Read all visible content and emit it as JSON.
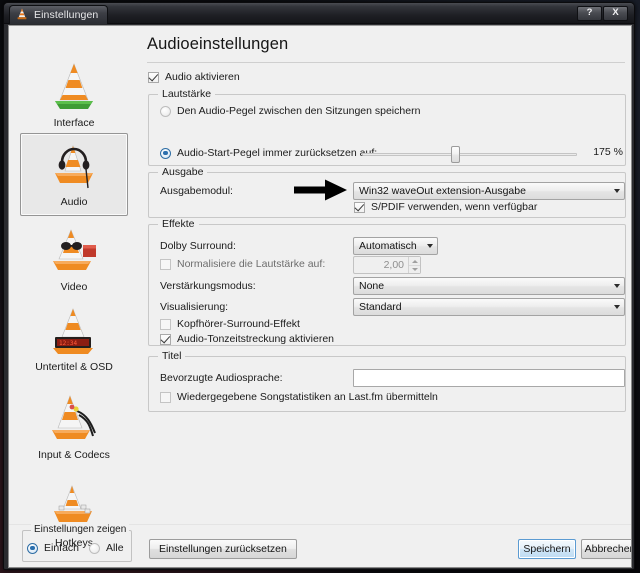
{
  "window": {
    "titlebar": {
      "icon": "vlc-cone-icon",
      "title": "Einstellungen",
      "help_label": "?",
      "close_label": "X"
    }
  },
  "sidebar": {
    "items": [
      {
        "label": "Interface",
        "icon": "vlc-cone-icon",
        "selected": false
      },
      {
        "label": "Audio",
        "icon": "vlc-headphones-icon",
        "selected": true
      },
      {
        "label": "Video",
        "icon": "vlc-video-glasses-icon",
        "selected": false
      },
      {
        "label": "Untertitel & OSD",
        "icon": "vlc-subtitles-icon",
        "selected": false
      },
      {
        "label": "Input & Codecs",
        "icon": "vlc-cables-icon",
        "selected": false
      },
      {
        "label": "Hotkeys",
        "icon": "vlc-keyboard-icon",
        "selected": false
      }
    ]
  },
  "show_settings": {
    "group_label": "Einstellungen zeigen",
    "simple_label": "Einfach",
    "all_label": "Alle",
    "selected": "Einfach"
  },
  "footer": {
    "reset_label": "Einstellungen zurücksetzen",
    "save_label": "Speichern",
    "cancel_label": "Abbrechen"
  },
  "page": {
    "title": "Audioeinstellungen",
    "enable_audio": {
      "label": "Audio aktivieren",
      "checked": true
    },
    "volume": {
      "group_label": "Lautstärke",
      "remember_label": "Den Audio-Pegel zwischen den Sitzungen speichern",
      "remember_selected": false,
      "always_reset_label": "Audio-Start-Pegel immer zurücksetzen auf:",
      "always_reset_selected": true,
      "slider_value_text": "175 %",
      "slider_percent": 43
    },
    "output": {
      "group_label": "Ausgabe",
      "module_label": "Ausgabemodul:",
      "module_value": "Win32 waveOut extension-Ausgabe",
      "spdif": {
        "label": "S/PDIF verwenden, wenn verfügbar",
        "checked": true
      },
      "annotation": "black-arrow-right-icon"
    },
    "effects": {
      "group_label": "Effekte",
      "dolby_label": "Dolby Surround:",
      "dolby_value": "Automatisch",
      "normalize": {
        "label": "Normalisiere die Lautstärke auf:",
        "checked": false,
        "value": "2,00",
        "disabled": true
      },
      "gain_label": "Verstärkungsmodus:",
      "gain_value": "None",
      "visual_label": "Visualisierung:",
      "visual_value": "Standard",
      "headphone": {
        "label": "Kopfhörer-Surround-Effekt",
        "checked": false
      },
      "timestretch": {
        "label": "Audio-Tonzeitstreckung aktivieren",
        "checked": true
      }
    },
    "track": {
      "group_label": "Titel",
      "language_label": "Bevorzugte Audiosprache:",
      "language_value": "",
      "lastfm": {
        "label": "Wiedergegebene Songstatistiken an Last.fm übermitteln",
        "checked": false
      }
    }
  },
  "colors": {
    "titlebar_dark": "#1e1f24",
    "client_bg": "#f0f0f0",
    "accent_focus": "#5b9bd2",
    "radio_accent": "#2b6fae",
    "vlc_orange": "#e8751a",
    "group_border": "#c8c8c8"
  }
}
